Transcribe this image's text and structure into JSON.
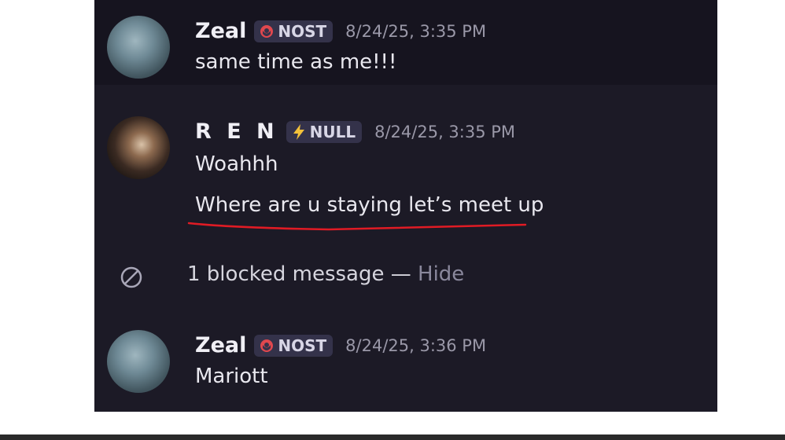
{
  "messages": [
    {
      "username": "Zeal",
      "tag": "NOST",
      "tag_icon": "red-helmet-icon",
      "timestamp": "8/24/25, 3:35 PM",
      "lines": [
        "same time as me!!!"
      ]
    },
    {
      "username": "R E N",
      "tag": "NULL",
      "tag_icon": "lightning-icon",
      "timestamp": "8/24/25, 3:35 PM",
      "lines": [
        "Woahhh",
        "Where are u staying let’s meet up"
      ]
    },
    {
      "username": "Zeal",
      "tag": "NOST",
      "tag_icon": "red-helmet-icon",
      "timestamp": "8/24/25, 3:36 PM",
      "lines": [
        "Mariott"
      ]
    }
  ],
  "blocked": {
    "text": "1 blocked message —",
    "action": "Hide"
  },
  "colors": {
    "background": "#1c1a26",
    "underline": "#e01b24",
    "tag_bg": "#34324a"
  }
}
